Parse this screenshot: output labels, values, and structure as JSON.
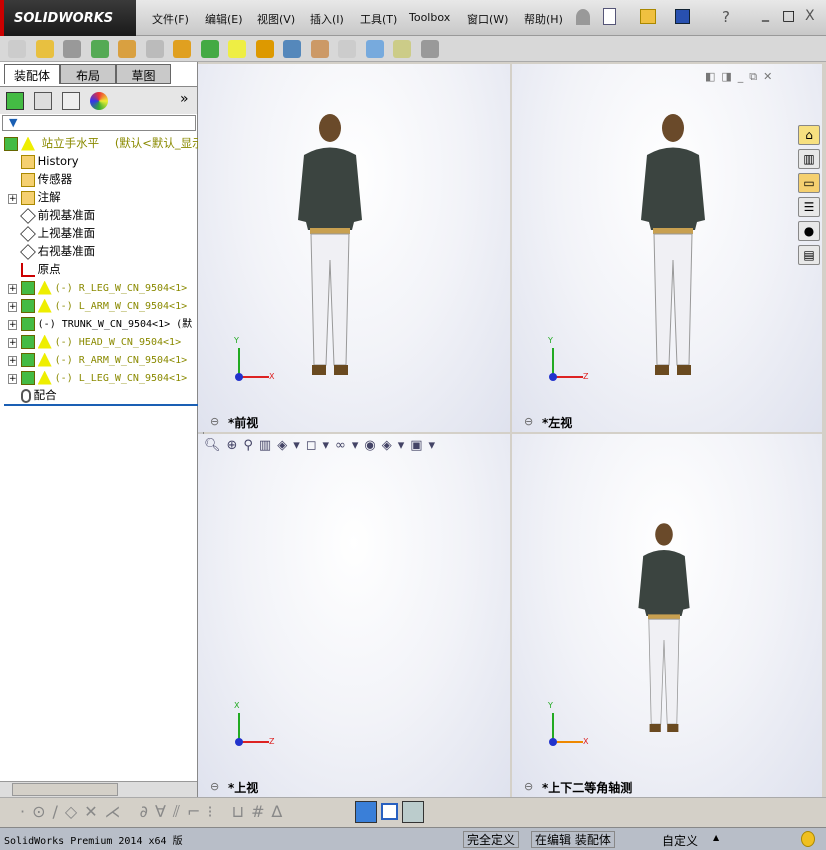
{
  "app": {
    "logo": "SOLIDWORKS"
  },
  "menu": [
    "文件(F)",
    "编辑(E)",
    "视图(V)",
    "插入(I)",
    "工具(T)",
    "Toolbox",
    "窗口(W)",
    "帮助(H)"
  ],
  "window_controls": {
    "help": "?",
    "minimize": "_",
    "restore": "□",
    "close": "X"
  },
  "left_tabs": [
    "装配体",
    "布局",
    "草图"
  ],
  "tree": {
    "root": {
      "name": "站立手水平",
      "config": "(默认<默认_显示"
    },
    "items": [
      {
        "label": "History",
        "type": "folder"
      },
      {
        "label": "传感器",
        "type": "folder"
      },
      {
        "label": "注解",
        "type": "folder",
        "expand": "+"
      },
      {
        "label": "前视基准面",
        "type": "plane"
      },
      {
        "label": "上视基准面",
        "type": "plane"
      },
      {
        "label": "右视基准面",
        "type": "plane"
      },
      {
        "label": "原点",
        "type": "origin"
      }
    ],
    "components": [
      {
        "label": "(-) R_LEG_W_CN_9504<1>",
        "warning": true
      },
      {
        "label": "(-) L_ARM_W_CN_9504<1>",
        "warning": true
      },
      {
        "label": "(-) TRUNK_W_CN_9504<1> (默",
        "warning": false
      },
      {
        "label": "(-) HEAD_W_CN_9504<1>",
        "warning": true
      },
      {
        "label": "(-) R_ARM_W_CN_9504<1>",
        "warning": true
      },
      {
        "label": "(-) L_LEG_W_CN_9504<1>",
        "warning": true
      }
    ],
    "mates": "配合"
  },
  "viewports": [
    {
      "label": "*前视",
      "axes": [
        "Y",
        "X"
      ]
    },
    {
      "label": "*左视",
      "axes": [
        "Y",
        "Z"
      ]
    },
    {
      "label": "*上视",
      "axes": [
        "X",
        "Z"
      ]
    },
    {
      "label": "*上下二等角轴测",
      "axes": [
        "Y",
        "X"
      ]
    }
  ],
  "status": {
    "product": "SolidWorks Premium 2014 x64 版",
    "defined": "完全定义",
    "editing": "在编辑 装配体",
    "units": "自定义",
    "arrow": "▲"
  },
  "colors": {
    "accent": "#1a5fb4",
    "warning": "#e8c000",
    "component_text": "#8a8a00"
  }
}
